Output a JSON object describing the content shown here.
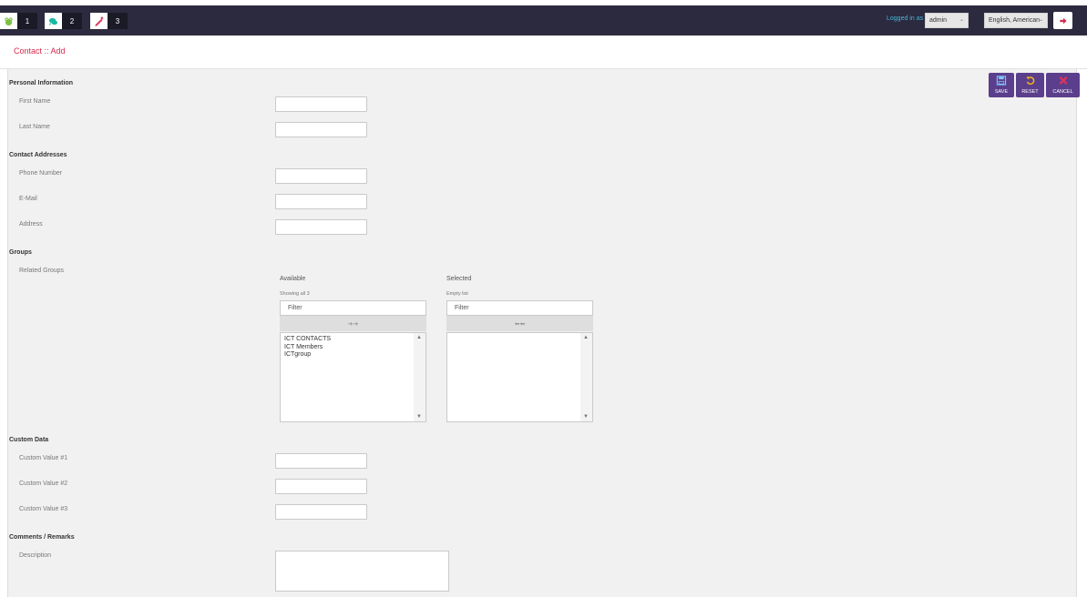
{
  "topbar": {
    "tabs": [
      {
        "icon": "frog-icon",
        "count": "1",
        "color": "#7cc242"
      },
      {
        "icon": "chat-icon",
        "count": "2",
        "color": "#19b9a3"
      },
      {
        "icon": "pen-icon",
        "count": "3",
        "color": "#e0325a"
      }
    ],
    "logged_label": "Logged in as :",
    "user": "admin",
    "language": "English, American",
    "logout_icon": "logout-icon"
  },
  "page": {
    "title": "Contact :: Add"
  },
  "actions": {
    "save": "SAVE",
    "reset": "RESET",
    "cancel": "CANCEL"
  },
  "sections": {
    "personal": "Personal Information",
    "addresses": "Contact Addresses",
    "groups": "Groups",
    "custom": "Custom Data",
    "comments": "Comments / Remarks"
  },
  "fields": {
    "first_name": "First Name",
    "last_name": "Last Name",
    "phone": "Phone Number",
    "email": "E-Mail",
    "address": "Address",
    "related_groups": "Related Groups",
    "custom1": "Custom Value #1",
    "custom2": "Custom Value #2",
    "custom3": "Custom Value #3",
    "description": "Description"
  },
  "dual_list": {
    "available": {
      "header": "Available",
      "count": "Showing all 3",
      "filter_placeholder": "Filter",
      "move": "➔➔",
      "options": [
        "ICT CONTACTS",
        "ICT Members",
        "ICTgroup"
      ]
    },
    "selected": {
      "header": "Selected",
      "count": "Empty list",
      "filter_placeholder": "Filter",
      "move": "⬅⬅"
    }
  },
  "colors": {
    "accent": "#d9284c",
    "topbar": "#2c2a3e",
    "button": "#5b3f8c"
  }
}
